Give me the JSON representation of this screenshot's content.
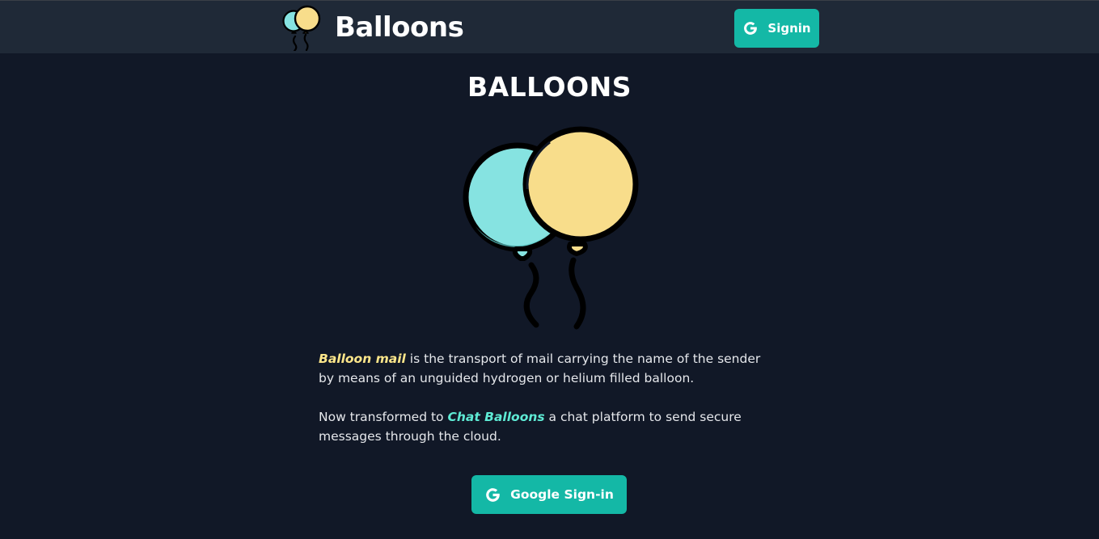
{
  "navbar": {
    "brand_name": "Balloons",
    "signin_label": "Signin",
    "signin_icon": "google-g-icon"
  },
  "hero": {
    "title": "BALLOONS",
    "illustration": "balloons-illustration",
    "paragraph_1": {
      "highlight": "Balloon mail",
      "text": " is the transport of mail carrying the name of the sender by means of an unguided hydrogen or helium filled balloon."
    },
    "paragraph_2": {
      "prefix": "Now transformed to ",
      "highlight": "Chat Balloons",
      "suffix": " a chat platform to send secure messages through the cloud."
    },
    "google_signin_label": "Google Sign-in",
    "google_signin_icon": "google-g-icon"
  },
  "colors": {
    "page_background": "#111827",
    "navbar_background": "#1f2937",
    "accent_teal": "#14b8a6",
    "highlight_yellow": "#fde68a",
    "highlight_teal": "#5eead4",
    "balloon_teal": "#86e3e1",
    "balloon_yellow": "#f8dd8b"
  }
}
